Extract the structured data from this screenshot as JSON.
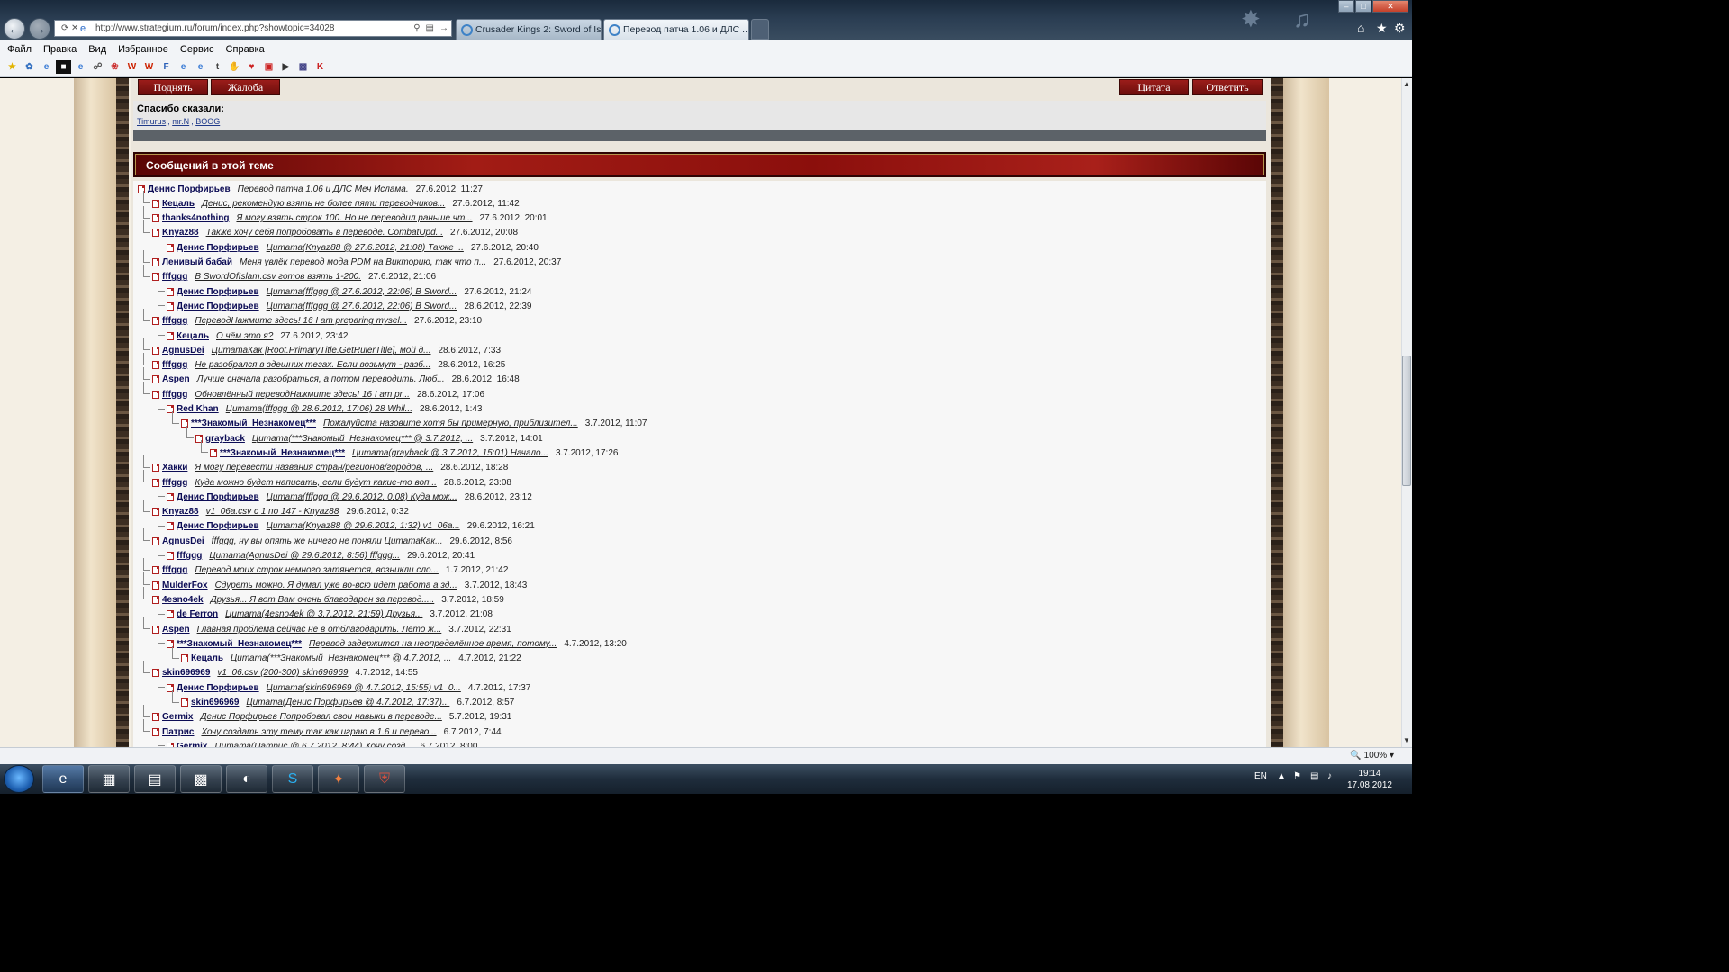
{
  "browser": {
    "url": "http://www.strategium.ru/forum/index.php?showtopic=34028",
    "tabs": [
      {
        "title": "Crusader Kings 2: Sword of Isla..."
      },
      {
        "title": "Перевод патча 1.06 и ДЛС ..."
      }
    ],
    "menu": [
      "Файл",
      "Правка",
      "Вид",
      "Избранное",
      "Сервис",
      "Справка"
    ],
    "zoom": "100%"
  },
  "post_actions": {
    "up_label": "Поднять",
    "report_label": "Жалоба",
    "quote_label": "Цитата",
    "reply_label": "Ответить"
  },
  "thanks": {
    "heading": "Спасибо сказали:",
    "users": [
      "Timurus",
      "mr.N",
      "BOOG"
    ]
  },
  "section_title": "Сообщений в этой теме",
  "tree": [
    {
      "d": 0,
      "author": "Денис Порфирьев",
      "snippet": "Перевод патча 1.06 и ДЛС Меч Ислама.",
      "date": "27.6.2012, 11:27"
    },
    {
      "d": 1,
      "author": "Кецаль",
      "snippet": "Денис, рекомендую взять не более пяти переводчиков...",
      "date": "27.6.2012, 11:42"
    },
    {
      "d": 1,
      "author": "thanks4nothing",
      "snippet": "Я могу взять строк 100. Но не переводил раньше чт...",
      "date": "27.6.2012, 20:01"
    },
    {
      "d": 1,
      "author": "Knyaz88",
      "snippet": "Также хочу себя попробовать в переводе. CombatUpd...",
      "date": "27.6.2012, 20:08"
    },
    {
      "d": 2,
      "author": "Денис Порфирьев",
      "snippet": "Цитата(Knyaz88 @ 27.6.2012, 21:08) Также ...",
      "date": "27.6.2012, 20:40"
    },
    {
      "d": 1,
      "author": "Ленивый бабай",
      "snippet": "Меня увлёк перевод мода PDM на Викторию, так что п...",
      "date": "27.6.2012, 20:37"
    },
    {
      "d": 1,
      "author": "fffggg",
      "snippet": "В SwordOfIslam.csv готов взять 1-200.",
      "date": "27.6.2012, 21:06"
    },
    {
      "d": 2,
      "author": "Денис Порфирьев",
      "snippet": "Цитата(fffggg @ 27.6.2012, 22:06) В Sword...",
      "date": "27.6.2012, 21:24"
    },
    {
      "d": 2,
      "author": "Денис Порфирьев",
      "snippet": "Цитата(fffggg @ 27.6.2012, 22:06) В Sword...",
      "date": "28.6.2012, 22:39"
    },
    {
      "d": 1,
      "author": "fffggg",
      "snippet": "ПереводНажмите здесь! 16 I am preparing mysel...",
      "date": "27.6.2012, 23:10"
    },
    {
      "d": 2,
      "author": "Кецаль",
      "snippet": "О чём это я?",
      "date": "27.6.2012, 23:42"
    },
    {
      "d": 1,
      "author": "AgnusDei",
      "snippet": "ЦитатаКак [Root.PrimaryTitle.GetRulerTitle], мой д...",
      "date": "28.6.2012, 7:33"
    },
    {
      "d": 1,
      "author": "fffggg",
      "snippet": "Не разобрался в здешних тегах. Если возьмут - разб...",
      "date": "28.6.2012, 16:25"
    },
    {
      "d": 1,
      "author": "Aspen",
      "snippet": "Лучше сначала разобраться, а потом переводить. Люб...",
      "date": "28.6.2012, 16:48"
    },
    {
      "d": 1,
      "author": "fffggg",
      "snippet": "Обновлённый переводНажмите здесь! 16 I am pr...",
      "date": "28.6.2012, 17:06"
    },
    {
      "d": 2,
      "author": "Red Khan",
      "snippet": "Цитата(fffggg @ 28.6.2012, 17:06) 28 Whil...",
      "date": "28.6.2012, 1:43"
    },
    {
      "d": 3,
      "author": "***Знакомый_Незнакомец***",
      "snippet": "Пожалуйста назовите хотя бы примерную, приблизител...",
      "date": "3.7.2012, 11:07"
    },
    {
      "d": 4,
      "author": "grayback",
      "snippet": "Цитата(***Знакомый_Незнакомец*** @ 3.7.2012, ...",
      "date": "3.7.2012, 14:01"
    },
    {
      "d": 5,
      "author": "***Знакомый_Незнакомец***",
      "snippet": "Цитата(grayback @ 3.7.2012, 15:01) Начало...",
      "date": "3.7.2012, 17:26"
    },
    {
      "d": 1,
      "author": "Хакки",
      "snippet": "Я могу перевести названия стран/регионов/городов, ...",
      "date": "28.6.2012, 18:28"
    },
    {
      "d": 1,
      "author": "fffggg",
      "snippet": "Куда можно будет написать, если будут какие-то воп...",
      "date": "28.6.2012, 23:08"
    },
    {
      "d": 2,
      "author": "Денис Порфирьев",
      "snippet": "Цитата(fffggg @ 29.6.2012, 0:08) Куда мож...",
      "date": "28.6.2012, 23:12"
    },
    {
      "d": 1,
      "author": "Knyaz88",
      "snippet": "v1_06a.csv с 1 по 147 - Knyaz88",
      "date": "29.6.2012, 0:32"
    },
    {
      "d": 2,
      "author": "Денис Порфирьев",
      "snippet": "Цитата(Knyaz88 @ 29.6.2012, 1:32) v1_06a...",
      "date": "29.6.2012, 16:21"
    },
    {
      "d": 1,
      "author": "AgnusDei",
      "snippet": "fffggg, ну вы опять же ничего не поняли ЦитатаКак...",
      "date": "29.6.2012, 8:56"
    },
    {
      "d": 2,
      "author": "fffggg",
      "snippet": "Цитата(AgnusDei @ 29.6.2012, 8:56) fffggg...",
      "date": "29.6.2012, 20:41"
    },
    {
      "d": 1,
      "author": "fffggg",
      "snippet": "Перевод моих строк немного затянется, возникли сло...",
      "date": "1.7.2012, 21:42"
    },
    {
      "d": 1,
      "author": "MulderFox",
      "snippet": "Сдуреть можно. Я думал уже во-всю идет работа а зд...",
      "date": "3.7.2012, 18:43"
    },
    {
      "d": 1,
      "author": "4esno4ek",
      "snippet": "Друзья... Я вот Вам очень благодарен за перевод.....",
      "date": "3.7.2012, 18:59"
    },
    {
      "d": 2,
      "author": "de Ferron",
      "snippet": "Цитата(4esno4ek @ 3.7.2012, 21:59) Друзья...",
      "date": "3.7.2012, 21:08"
    },
    {
      "d": 1,
      "author": "Aspen",
      "snippet": "Главная проблема сейчас не в отблагодарить. Лето ж...",
      "date": "3.7.2012, 22:31"
    },
    {
      "d": 2,
      "author": "***Знакомый_Незнакомец***",
      "snippet": "Перевод задержится на неопределённое время, потому...",
      "date": "4.7.2012, 13:20"
    },
    {
      "d": 3,
      "author": "Кецаль",
      "snippet": "Цитата(***Знакомый_Незнакомец*** @ 4.7.2012, ...",
      "date": "4.7.2012, 21:22"
    },
    {
      "d": 1,
      "author": "skin696969",
      "snippet": "v1_06.csv (200-300) skin696969",
      "date": "4.7.2012, 14:55"
    },
    {
      "d": 2,
      "author": "Денис Порфирьев",
      "snippet": "Цитата(skin696969 @ 4.7.2012, 15:55) v1_0...",
      "date": "4.7.2012, 17:37"
    },
    {
      "d": 3,
      "author": "skin696969",
      "snippet": "Цитата(Денис Порфирьев @ 4.7.2012, 17:37)...",
      "date": "6.7.2012, 8:57"
    },
    {
      "d": 1,
      "author": "Germix",
      "snippet": "Денис Порфирьев Попробовал свои навыки в переводе...",
      "date": "5.7.2012, 19:31"
    },
    {
      "d": 1,
      "author": "Патрис",
      "snippet": "Хочу создать эту тему так как играю в 1.6 и перево...",
      "date": "6.7.2012, 7:44"
    },
    {
      "d": 2,
      "author": "Germix",
      "snippet": "Цитата(Патрис @ 6.7.2012, 8:44) Хочу созд...",
      "date": "6.7.2012, 8:00"
    }
  ],
  "taskbar": {
    "lang": "EN",
    "time": "19:14",
    "date": "17.08.2012"
  }
}
